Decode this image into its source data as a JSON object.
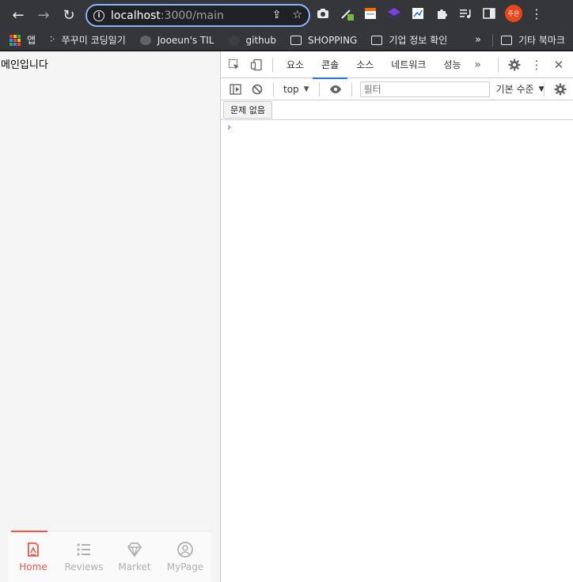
{
  "browser": {
    "url_host": "localhost",
    "url_path": ":3000/main",
    "profile_label": "주은"
  },
  "bookmarks": [
    {
      "label": "앱",
      "icon": "apps-grid-icon"
    },
    {
      "label": "쭈꾸미 코딩일기",
      "icon": "dots-icon"
    },
    {
      "label": "Jooeun's TIL",
      "icon": "globe-icon"
    },
    {
      "label": "github",
      "icon": "github-icon"
    },
    {
      "label": "SHOPPING",
      "icon": "folder-icon"
    },
    {
      "label": "기업 정보 확인",
      "icon": "folder-icon"
    },
    {
      "label": "기타 북마크",
      "icon": "folder-icon"
    }
  ],
  "page": {
    "main_text": "메인입니다"
  },
  "bottom_nav": {
    "items": [
      {
        "label": "Home",
        "icon": "home-icon",
        "active": true
      },
      {
        "label": "Reviews",
        "icon": "list-icon",
        "active": false
      },
      {
        "label": "Market",
        "icon": "diamond-icon",
        "active": false
      },
      {
        "label": "MyPage",
        "icon": "user-circle-icon",
        "active": false
      }
    ],
    "active_color": "#e35a4b"
  },
  "devtools": {
    "tabs": [
      "요소",
      "콘솔",
      "소스",
      "네트워크",
      "성능"
    ],
    "active_tab": "콘솔",
    "context": "top",
    "filter_placeholder": "필터",
    "levels_label": "기본 수준",
    "issues_label": "문제 없음",
    "prompt": "›"
  },
  "colors": {
    "accent": "#1a73e8",
    "chrome_bar": "#35363a"
  }
}
